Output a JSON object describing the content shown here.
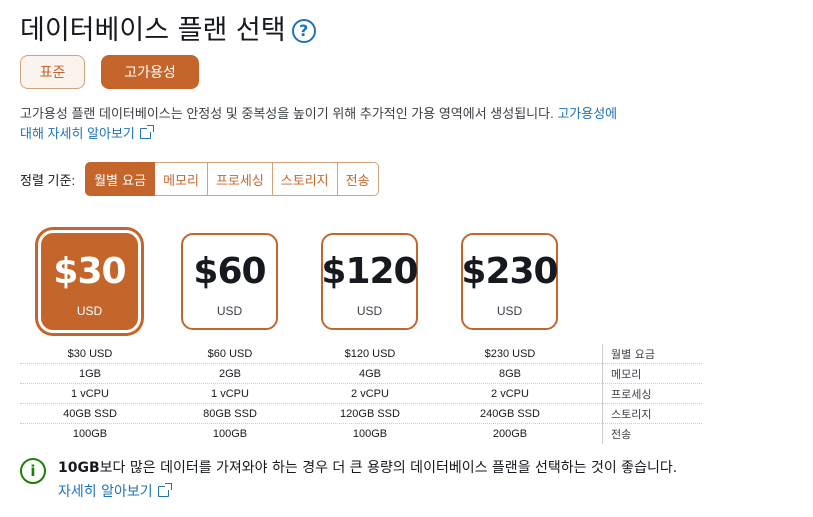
{
  "header": {
    "title": "데이터베이스 플랜 선택",
    "help_icon": "?"
  },
  "plan_types": [
    {
      "label": "표준",
      "selected": false
    },
    {
      "label": "고가용성",
      "selected": true
    }
  ],
  "description": {
    "text": "고가용성 플랜 데이터베이스는 안정성 및 중복성을 높이기 위해 추가적인 가용 영역에서 생성됩니다.",
    "link_text": "고가용성에 대해 자세히 알아보기"
  },
  "sort": {
    "label": "정렬 기준:",
    "options": [
      "월별 요금",
      "메모리",
      "프로세싱",
      "스토리지",
      "전송"
    ],
    "active": "월별 요금"
  },
  "plans": [
    {
      "price": "$30",
      "currency": "USD",
      "selected": true
    },
    {
      "price": "$60",
      "currency": "USD",
      "selected": false
    },
    {
      "price": "$120",
      "currency": "USD",
      "selected": false
    },
    {
      "price": "$230",
      "currency": "USD",
      "selected": false
    }
  ],
  "specs": [
    {
      "values": [
        "$30 USD",
        "$60 USD",
        "$120 USD",
        "$230 USD"
      ],
      "label": "월별 요금"
    },
    {
      "values": [
        "1GB",
        "2GB",
        "4GB",
        "8GB"
      ],
      "label": "메모리"
    },
    {
      "values": [
        "1 vCPU",
        "1 vCPU",
        "2 vCPU",
        "2 vCPU"
      ],
      "label": "프로세싱"
    },
    {
      "values": [
        "40GB SSD",
        "80GB SSD",
        "120GB SSD",
        "240GB SSD"
      ],
      "label": "스토리지"
    },
    {
      "values": [
        "100GB",
        "100GB",
        "100GB",
        "200GB"
      ],
      "label": "전송"
    }
  ],
  "info": {
    "bold": "10GB",
    "text": "보다 많은 데이터를 가져와야 하는 경우 더 큰 용량의 데이터베이스 플랜을 선택하는 것이 좋습니다.",
    "link_text": "자세히 알아보기"
  },
  "colors": {
    "accent": "#c4662c",
    "link": "#2073b6",
    "info": "#1d8102"
  }
}
